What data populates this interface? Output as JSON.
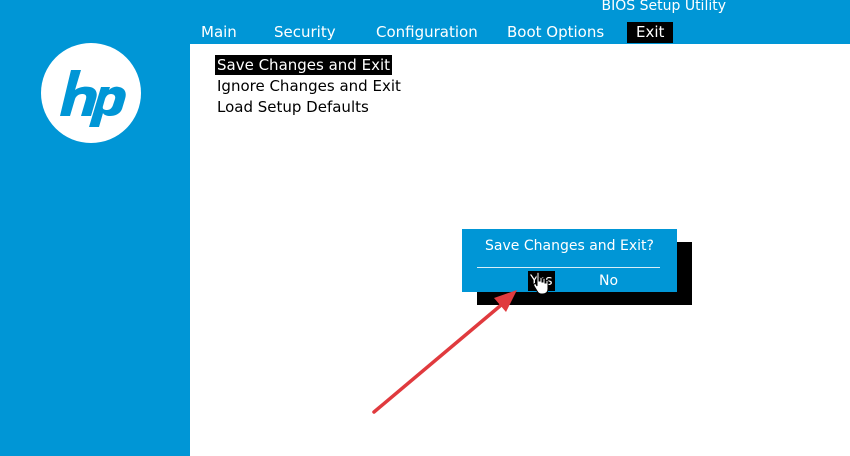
{
  "brand": {
    "logo_text": "hp"
  },
  "utility_title": "BIOS Setup Utility",
  "tabs": [
    {
      "label": "Main"
    },
    {
      "label": "Security"
    },
    {
      "label": "Configuration"
    },
    {
      "label": "Boot Options"
    },
    {
      "label": "Exit",
      "active": true
    }
  ],
  "exit_menu": [
    {
      "label": "Save Changes and Exit",
      "selected": true
    },
    {
      "label": "Ignore Changes and Exit"
    },
    {
      "label": "Load Setup Defaults"
    }
  ],
  "dialog": {
    "title": "Save Changes and Exit?",
    "yes_label": "Yes",
    "no_label": "No",
    "selected": "Yes"
  },
  "colors": {
    "bios_blue": "#0096d6",
    "highlight": "#000000",
    "annotation_arrow": "#e03a3e"
  },
  "icons": {
    "pointer": "hand-pointer-icon",
    "annotation": "red-arrow-icon"
  }
}
